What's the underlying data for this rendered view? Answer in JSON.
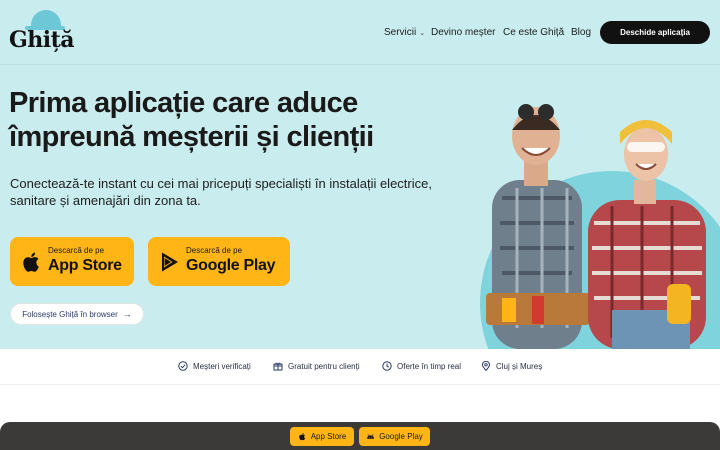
{
  "brand": {
    "logo_text": "Ghiță"
  },
  "nav": {
    "services": "Servicii",
    "become": "Devino meșter",
    "what": "Ce este Ghiță",
    "blog": "Blog",
    "cta": "Deschide aplicația"
  },
  "hero": {
    "headline_line1": "Prima aplicație care aduce",
    "headline_line2": "împreună meșterii și clienții",
    "subtext": "Conectează-te instant cu cei mai pricepuți specialiști în instalații electrice, sanitare și amenajări din zona ta.",
    "app_store": {
      "pre": "Descarcă de pe",
      "main": "App Store"
    },
    "google_play": {
      "pre": "Descarcă de pe",
      "main": "Google Play"
    },
    "browser_label": "Folosește Ghiță în browser"
  },
  "features": [
    {
      "label": "Meșteri verificați",
      "icon": "check-circle-icon"
    },
    {
      "label": "Gratuit pentru clienți",
      "icon": "gift-icon"
    },
    {
      "label": "Oferte în timp real",
      "icon": "clock-icon"
    },
    {
      "label": "Cluj și Mureș",
      "icon": "location-pin-icon"
    }
  ],
  "sticky_bar": {
    "app_store": "App Store",
    "google_play": "Google Play"
  },
  "colors": {
    "hero_bg": "#c9ecef",
    "accent": "#ffb515",
    "dark": "#111111",
    "logo_teal": "#6cc7d6"
  }
}
